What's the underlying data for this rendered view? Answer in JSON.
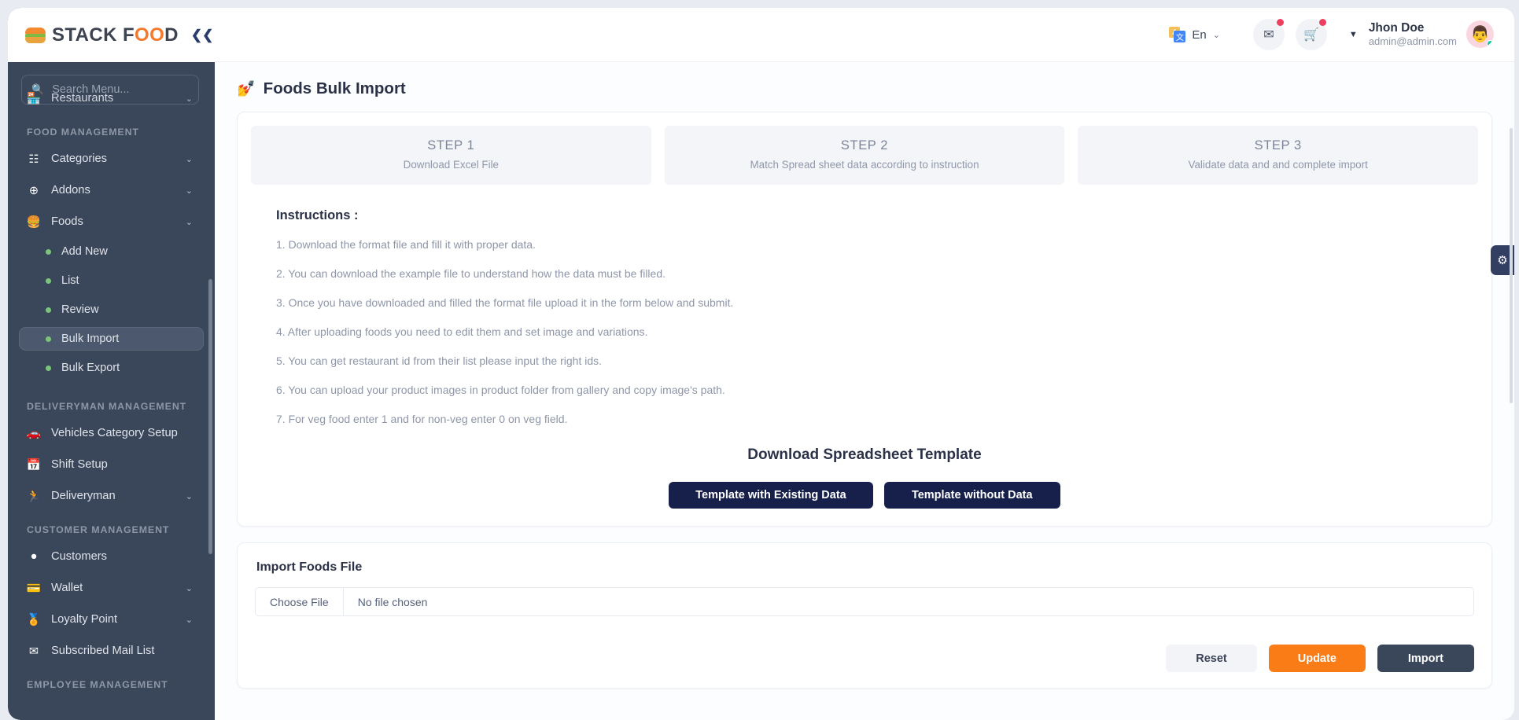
{
  "brand": {
    "name_part1": "STACK F",
    "name_oo": "OO",
    "name_part2": "D",
    "collapse_icon": "❮❮"
  },
  "sidebar": {
    "search_placeholder": "Search Menu...",
    "search_icon": "search-icon",
    "partial_top_item": "Restaurants",
    "groups": [
      {
        "title": "FOOD MANAGEMENT",
        "items": [
          {
            "label": "Categories",
            "icon": "sitemap-icon",
            "has_caret": true
          },
          {
            "label": "Addons",
            "icon": "plus-circle-icon",
            "has_caret": true
          },
          {
            "label": "Foods",
            "icon": "burger-icon",
            "has_caret": true
          }
        ],
        "sub_items": [
          {
            "label": "Add New",
            "active": false
          },
          {
            "label": "List",
            "active": false
          },
          {
            "label": "Review",
            "active": false
          },
          {
            "label": "Bulk Import",
            "active": true
          },
          {
            "label": "Bulk Export",
            "active": false
          }
        ]
      },
      {
        "title": "DELIVERYMAN MANAGEMENT",
        "items": [
          {
            "label": "Vehicles Category Setup",
            "icon": "car-icon",
            "has_caret": false
          },
          {
            "label": "Shift Setup",
            "icon": "calendar-icon",
            "has_caret": false
          },
          {
            "label": "Deliveryman",
            "icon": "runner-icon",
            "has_caret": true
          }
        ],
        "sub_items": []
      },
      {
        "title": "CUSTOMER MANAGEMENT",
        "items": [
          {
            "label": "Customers",
            "icon": "user-pin-icon",
            "has_caret": false
          },
          {
            "label": "Wallet",
            "icon": "wallet-icon",
            "has_caret": true
          },
          {
            "label": "Loyalty Point",
            "icon": "medal-icon",
            "has_caret": true
          },
          {
            "label": "Subscribed Mail List",
            "icon": "envelope-icon",
            "has_caret": false
          }
        ],
        "sub_items": []
      },
      {
        "title": "EMPLOYEE MANAGEMENT",
        "items": [],
        "sub_items": []
      }
    ]
  },
  "topbar": {
    "language": {
      "label": "En",
      "icon": "translate-icon",
      "caret": "⌄"
    },
    "mail_button": {
      "icon": "mail-icon",
      "has_badge": true
    },
    "cart_button": {
      "icon": "cart-icon",
      "has_badge": true
    },
    "user": {
      "caret": "▼",
      "name": "Jhon Doe",
      "email": "admin@admin.com",
      "avatar_icon": "avatar",
      "online": true
    }
  },
  "main": {
    "page_title": "Foods Bulk Import",
    "page_title_icon": "bulk-import-icon",
    "steps": [
      {
        "heading": "STEP 1",
        "subtitle": "Download Excel File"
      },
      {
        "heading": "STEP 2",
        "subtitle": "Match Spread sheet data according to instruction"
      },
      {
        "heading": "STEP 3",
        "subtitle": "Validate data and and complete import"
      }
    ],
    "instructions_title": "Instructions :",
    "instructions": [
      "1. Download the format file and fill it with proper data.",
      "2. You can download the example file to understand how the data must be filled.",
      "3. Once you have downloaded and filled the format file upload it in the form below and submit.",
      "4. After uploading foods you need to edit them and set image and variations.",
      "5. You can get restaurant id from their list please input the right ids.",
      "6. You can upload your product images in product folder from gallery and copy image's path.",
      "7. For veg food enter 1 and for non-veg enter 0 on veg field."
    ],
    "download_title": "Download Spreadsheet Template",
    "download_buttons": [
      "Template with Existing Data",
      "Template without Data"
    ],
    "import_section_title": "Import Foods File",
    "file_input": {
      "button_label": "Choose File",
      "value": "No file chosen"
    },
    "actions": {
      "reset": "Reset",
      "update": "Update",
      "import": "Import"
    },
    "settings_tab_icon": "gear-icon"
  },
  "colors": {
    "sidebar_bg": "#3a4659",
    "accent_orange": "#f97c16",
    "navy_button": "#16204b",
    "dark_button": "#3a4659",
    "badge_red": "#ef3f5f",
    "online_green": "#19c9a3"
  }
}
